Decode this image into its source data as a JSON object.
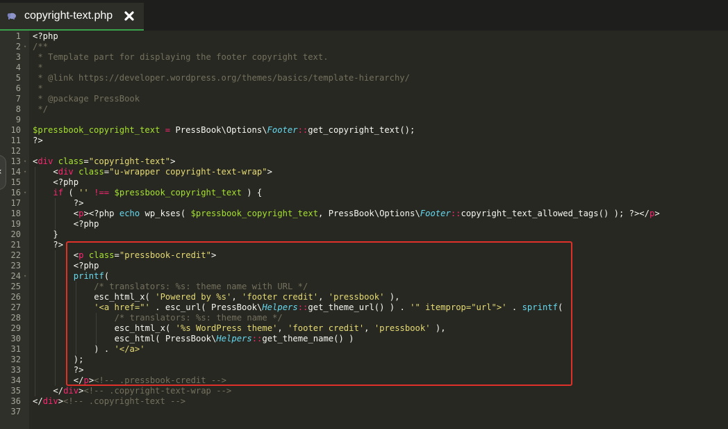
{
  "tab": {
    "title": "copyright-text.php",
    "icon": "php-elephant-icon",
    "close_icon": "close-x-icon",
    "accent": "#3aa24a"
  },
  "side_handle": {
    "glyph": "‹",
    "icon": "chevron-left-icon"
  },
  "highlight_color": "#e0302a",
  "lines": [
    {
      "n": "1",
      "indent": 0,
      "tokens": [
        [
          "<?php",
          "pl"
        ]
      ]
    },
    {
      "n": "2",
      "indent": 0,
      "fold": true,
      "tokens": [
        [
          "/**",
          "cm"
        ]
      ]
    },
    {
      "n": "3",
      "indent": 0,
      "tokens": [
        [
          " * Template part for displaying the footer copyright text.",
          "cm"
        ]
      ]
    },
    {
      "n": "4",
      "indent": 0,
      "tokens": [
        [
          " *",
          "cm"
        ]
      ]
    },
    {
      "n": "5",
      "indent": 0,
      "tokens": [
        [
          " * @link https://developer.wordpress.org/themes/basics/template-hierarchy/",
          "cm"
        ]
      ]
    },
    {
      "n": "6",
      "indent": 0,
      "tokens": [
        [
          " *",
          "cm"
        ]
      ]
    },
    {
      "n": "7",
      "indent": 0,
      "tokens": [
        [
          " * @package PressBook",
          "cm"
        ]
      ]
    },
    {
      "n": "8",
      "indent": 0,
      "tokens": [
        [
          " */",
          "cm"
        ]
      ]
    },
    {
      "n": "9",
      "indent": 0,
      "tokens": []
    },
    {
      "n": "10",
      "indent": 0,
      "tokens": [
        [
          "$pressbook_copyright_text",
          "var"
        ],
        [
          " ",
          "pl"
        ],
        [
          "=",
          "op"
        ],
        [
          " PressBook\\Options\\",
          "pl"
        ],
        [
          "Footer",
          "cls"
        ],
        [
          "::",
          "op"
        ],
        [
          "get_copyright_text();",
          "pl"
        ]
      ]
    },
    {
      "n": "11",
      "indent": 0,
      "tokens": [
        [
          "?>",
          "pl"
        ]
      ]
    },
    {
      "n": "12",
      "indent": 0,
      "tokens": []
    },
    {
      "n": "13",
      "indent": 0,
      "fold": true,
      "tokens": [
        [
          "<",
          "pl"
        ],
        [
          "div",
          "tag"
        ],
        [
          " ",
          "pl"
        ],
        [
          "class",
          "attr"
        ],
        [
          "=",
          "pl"
        ],
        [
          "\"copyright-text\"",
          "str"
        ],
        [
          ">",
          "pl"
        ]
      ]
    },
    {
      "n": "14",
      "indent": 1,
      "fold": true,
      "tokens": [
        [
          "<",
          "pl"
        ],
        [
          "div",
          "tag"
        ],
        [
          " ",
          "pl"
        ],
        [
          "class",
          "attr"
        ],
        [
          "=",
          "pl"
        ],
        [
          "\"u-wrapper copyright-text-wrap\"",
          "str"
        ],
        [
          ">",
          "pl"
        ]
      ]
    },
    {
      "n": "15",
      "indent": 1,
      "tokens": [
        [
          "<?php",
          "pl"
        ]
      ]
    },
    {
      "n": "16",
      "indent": 1,
      "fold": true,
      "tokens": [
        [
          "if",
          "tag"
        ],
        [
          " ( ",
          "pl"
        ],
        [
          "''",
          "str"
        ],
        [
          " ",
          "pl"
        ],
        [
          "!==",
          "op"
        ],
        [
          " ",
          "pl"
        ],
        [
          "$pressbook_copyright_text",
          "var"
        ],
        [
          " ) {",
          "pl"
        ]
      ]
    },
    {
      "n": "17",
      "indent": 2,
      "tokens": [
        [
          "?>",
          "pl"
        ]
      ]
    },
    {
      "n": "18",
      "indent": 2,
      "tokens": [
        [
          "<",
          "pl"
        ],
        [
          "p",
          "tag"
        ],
        [
          "><?php ",
          "pl"
        ],
        [
          "echo",
          "kw"
        ],
        [
          " wp_kses( ",
          "pl"
        ],
        [
          "$pressbook_copyright_text",
          "var"
        ],
        [
          ", PressBook\\Options\\",
          "pl"
        ],
        [
          "Footer",
          "cls"
        ],
        [
          "::",
          "op"
        ],
        [
          "copyright_text_allowed_tags() ); ?></",
          "pl"
        ],
        [
          "p",
          "tag"
        ],
        [
          ">",
          "pl"
        ]
      ]
    },
    {
      "n": "19",
      "indent": 2,
      "tokens": [
        [
          "<?php",
          "pl"
        ]
      ]
    },
    {
      "n": "20",
      "indent": 1,
      "tokens": [
        [
          "}",
          "pl"
        ]
      ]
    },
    {
      "n": "21",
      "indent": 1,
      "tokens": [
        [
          "?>",
          "pl"
        ]
      ]
    },
    {
      "n": "22",
      "indent": 2,
      "tokens": [
        [
          "<",
          "pl"
        ],
        [
          "p",
          "tag"
        ],
        [
          " ",
          "pl"
        ],
        [
          "class",
          "attr"
        ],
        [
          "=",
          "pl"
        ],
        [
          "\"pressbook-credit\"",
          "str"
        ],
        [
          ">",
          "pl"
        ]
      ]
    },
    {
      "n": "23",
      "indent": 2,
      "tokens": [
        [
          "<?php",
          "pl"
        ]
      ]
    },
    {
      "n": "24",
      "indent": 2,
      "fold": true,
      "tokens": [
        [
          "printf",
          "kw"
        ],
        [
          "(",
          "pl"
        ]
      ]
    },
    {
      "n": "25",
      "indent": 3,
      "tokens": [
        [
          "/* translators: %s: theme name with URL */",
          "cm"
        ]
      ]
    },
    {
      "n": "26",
      "indent": 3,
      "tokens": [
        [
          "esc_html_x( ",
          "pl"
        ],
        [
          "'Powered by %s'",
          "str"
        ],
        [
          ", ",
          "pl"
        ],
        [
          "'footer credit'",
          "str"
        ],
        [
          ", ",
          "pl"
        ],
        [
          "'pressbook'",
          "str"
        ],
        [
          " ),",
          "pl"
        ]
      ]
    },
    {
      "n": "27",
      "indent": 3,
      "tokens": [
        [
          "'<a href=\"'",
          "str"
        ],
        [
          " . esc_url( PressBook\\",
          "pl"
        ],
        [
          "Helpers",
          "cls"
        ],
        [
          "::",
          "op"
        ],
        [
          "get_theme_url() ) . ",
          "pl"
        ],
        [
          "'\" itemprop=\"url\">'",
          "str"
        ],
        [
          " . ",
          "pl"
        ],
        [
          "sprintf",
          "kw"
        ],
        [
          "(",
          "pl"
        ]
      ]
    },
    {
      "n": "28",
      "indent": 4,
      "tokens": [
        [
          "/* translators: %s: theme name */",
          "cm"
        ]
      ]
    },
    {
      "n": "29",
      "indent": 4,
      "tokens": [
        [
          "esc_html_x( ",
          "pl"
        ],
        [
          "'%s WordPress theme'",
          "str"
        ],
        [
          ", ",
          "pl"
        ],
        [
          "'footer credit'",
          "str"
        ],
        [
          ", ",
          "pl"
        ],
        [
          "'pressbook'",
          "str"
        ],
        [
          " ),",
          "pl"
        ]
      ]
    },
    {
      "n": "30",
      "indent": 4,
      "tokens": [
        [
          "esc_html( PressBook\\",
          "pl"
        ],
        [
          "Helpers",
          "cls"
        ],
        [
          "::",
          "op"
        ],
        [
          "get_theme_name() )",
          "pl"
        ]
      ]
    },
    {
      "n": "31",
      "indent": 3,
      "tokens": [
        [
          ") . ",
          "pl"
        ],
        [
          "'</a>'",
          "str"
        ]
      ]
    },
    {
      "n": "32",
      "indent": 2,
      "tokens": [
        [
          ");",
          "pl"
        ]
      ]
    },
    {
      "n": "33",
      "indent": 2,
      "tokens": [
        [
          "?>",
          "pl"
        ]
      ]
    },
    {
      "n": "34",
      "indent": 2,
      "tokens": [
        [
          "</",
          "pl"
        ],
        [
          "p",
          "tag"
        ],
        [
          ">",
          "pl"
        ],
        [
          "<!-- .pressbook-credit -->",
          "cm"
        ]
      ]
    },
    {
      "n": "35",
      "indent": 1,
      "tokens": [
        [
          "</",
          "pl"
        ],
        [
          "div",
          "tag"
        ],
        [
          ">",
          "pl"
        ],
        [
          "<!-- .copyright-text-wrap -->",
          "cm"
        ]
      ]
    },
    {
      "n": "36",
      "indent": 0,
      "tokens": [
        [
          "</",
          "pl"
        ],
        [
          "div",
          "tag"
        ],
        [
          ">",
          "pl"
        ],
        [
          "<!-- .copyright-text -->",
          "cm"
        ]
      ]
    },
    {
      "n": "37",
      "indent": 0,
      "tokens": []
    }
  ]
}
